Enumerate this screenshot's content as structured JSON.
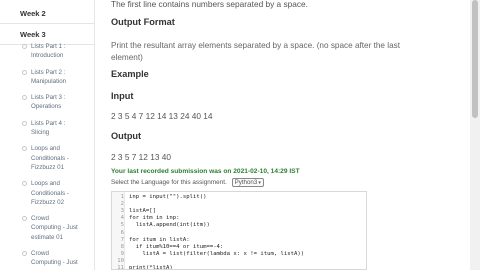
{
  "sidebar": {
    "weeks": [
      "Week 2",
      "Week 3"
    ],
    "lessons": [
      [
        "Lists Part 1 :",
        "Introduction"
      ],
      [
        "Lists Part 2 :",
        "Manipulation"
      ],
      [
        "Lists Part 3 :",
        "Operations"
      ],
      [
        "Lists Part 4 :",
        "Slicing"
      ],
      [
        "Loops and",
        "Conditionals -",
        "Fizzbuzz 01"
      ],
      [
        "Loops and",
        "Conditionals -",
        "Fizzbuzz 02"
      ],
      [
        "Crowd",
        "Computing - Just",
        "estimate 01"
      ],
      [
        "Crowd",
        "Computing - Just"
      ]
    ]
  },
  "main": {
    "input_desc": "The first line contains numbers separated by a space.",
    "output_format_heading": "Output Format",
    "output_desc_1": "Print the resultant array elements separated by a space. (no space after the last",
    "output_desc_2": "element)",
    "example_heading": "Example",
    "input_heading": "Input",
    "input_value": "2 3 5 4 7 12 14 13 24 40 14",
    "output_heading": "Output",
    "output_value": "2 3 5 7 12 13 40",
    "submission_text": "Your last recorded submission was on 2021-02-10, 14:29 IST",
    "language_label": "Select the Language for this assignment.",
    "language_value": "Python3"
  },
  "code_lines": [
    "inp = input(\"\").split()",
    "",
    "listA=[]",
    "for itm in inp:",
    "  listA.append(int(itm))",
    "",
    "for itum in listA:",
    "  if itum%10==4 or itum==-4:",
    "    listA = list(filter(lambda x: x != itum, listA))",
    "",
    "print(*listA)"
  ],
  "colors": {
    "accent_green": "#2e7d32",
    "sidebar_text": "#5f6f80"
  }
}
